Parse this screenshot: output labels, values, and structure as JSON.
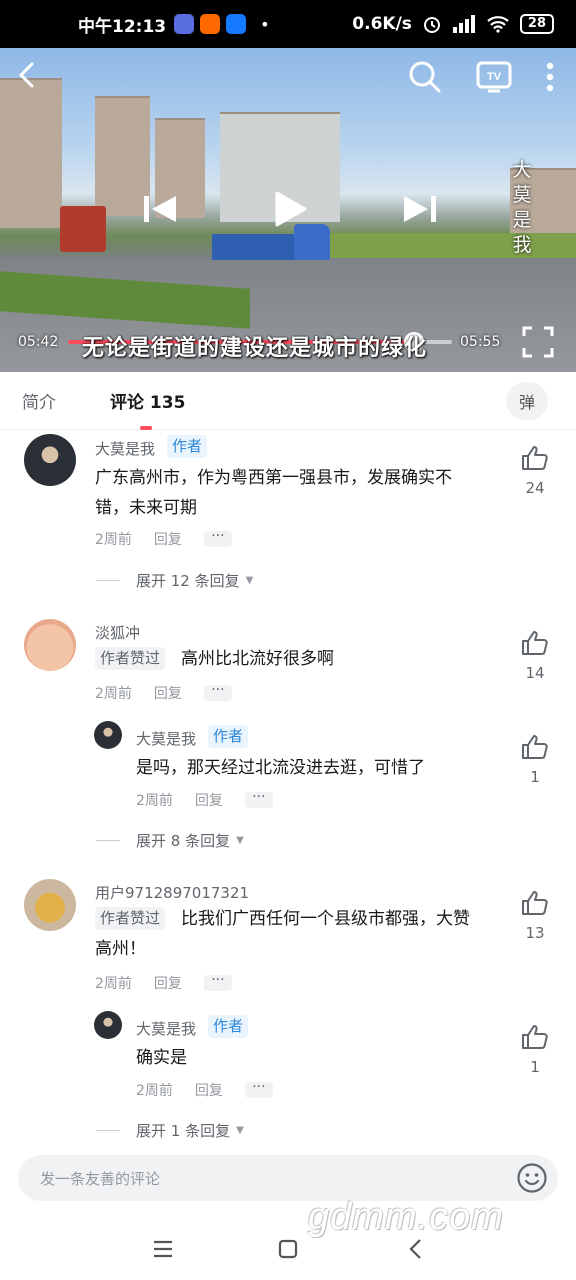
{
  "status_bar": {
    "time": "中午12:13",
    "network_speed": "0.6K/s",
    "battery": "28",
    "dot": "•"
  },
  "video": {
    "side_text": [
      "大",
      "莫",
      "是",
      "我"
    ],
    "current_time": "05:42",
    "total_time": "05:55",
    "progress": 0.9,
    "subtitle": "无论是街道的建设还是城市的绿化"
  },
  "tabs": {
    "intro": "简介",
    "comments": "评论 135",
    "danmaku": "弹"
  },
  "comments": [
    {
      "user": "大莫是我",
      "badge": "作者",
      "text": [
        "广东高州市，作为粤西第一强县市，发展确实不",
        "错，未来可期"
      ],
      "time": "2周前",
      "reply": "回复",
      "likes": "24",
      "expand": "展开 12 条回复"
    },
    {
      "user": "淡狐冲",
      "badge": "作者赞过",
      "text": "高州比北流好很多啊",
      "time": "2周前",
      "reply": "回复",
      "likes": "14",
      "sub_reply": {
        "user": "大莫是我",
        "badge": "作者",
        "text": "是吗，那天经过北流没进去逛，可惜了",
        "time": "2周前",
        "reply": "回复",
        "likes": "1"
      },
      "expand": "展开 8 条回复"
    },
    {
      "user": "用户9712897017321",
      "badge": "作者赞过",
      "text": [
        "比我们广西任何一个县级市都强，大赞",
        "高州！"
      ],
      "time": "2周前",
      "reply": "回复",
      "likes": "13",
      "sub_reply": {
        "user": "大莫是我",
        "badge": "作者",
        "text": "确实是",
        "time": "2周前",
        "reply": "回复",
        "likes": "1"
      },
      "expand": "展开 1 条回复"
    }
  ],
  "input": {
    "placeholder": "发一条友善的评论"
  },
  "watermark": "gdmm.com",
  "colors": {
    "accent": "#fb4c5e",
    "author_badge": "#2e88d8",
    "secondary_text": "#61666d"
  }
}
